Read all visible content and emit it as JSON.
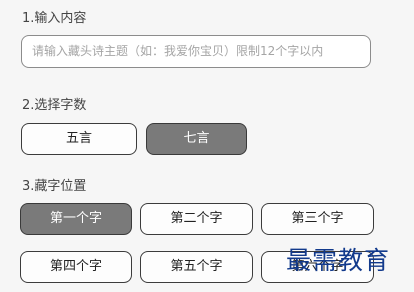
{
  "section_input": {
    "title": "1.输入内容",
    "placeholder": "请输入藏头诗主题（如：我爱你宝贝）限制12个字以内"
  },
  "section_words": {
    "title": "2.选择字数",
    "options": [
      {
        "label": "五言",
        "selected": false
      },
      {
        "label": "七言",
        "selected": true
      }
    ]
  },
  "section_position": {
    "title": "3.藏字位置",
    "options": [
      {
        "label": "第一个字",
        "selected": true
      },
      {
        "label": "第二个字",
        "selected": false
      },
      {
        "label": "第三个字",
        "selected": false
      },
      {
        "label": "第四个字",
        "selected": false
      },
      {
        "label": "第五个字",
        "selected": false
      },
      {
        "label": "第六个字",
        "selected": false
      }
    ]
  },
  "watermark": "最需教育",
  "colors": {
    "selected_bg": "#7a7a7a",
    "border": "#3c3c3c",
    "watermark": "#123a8c"
  }
}
